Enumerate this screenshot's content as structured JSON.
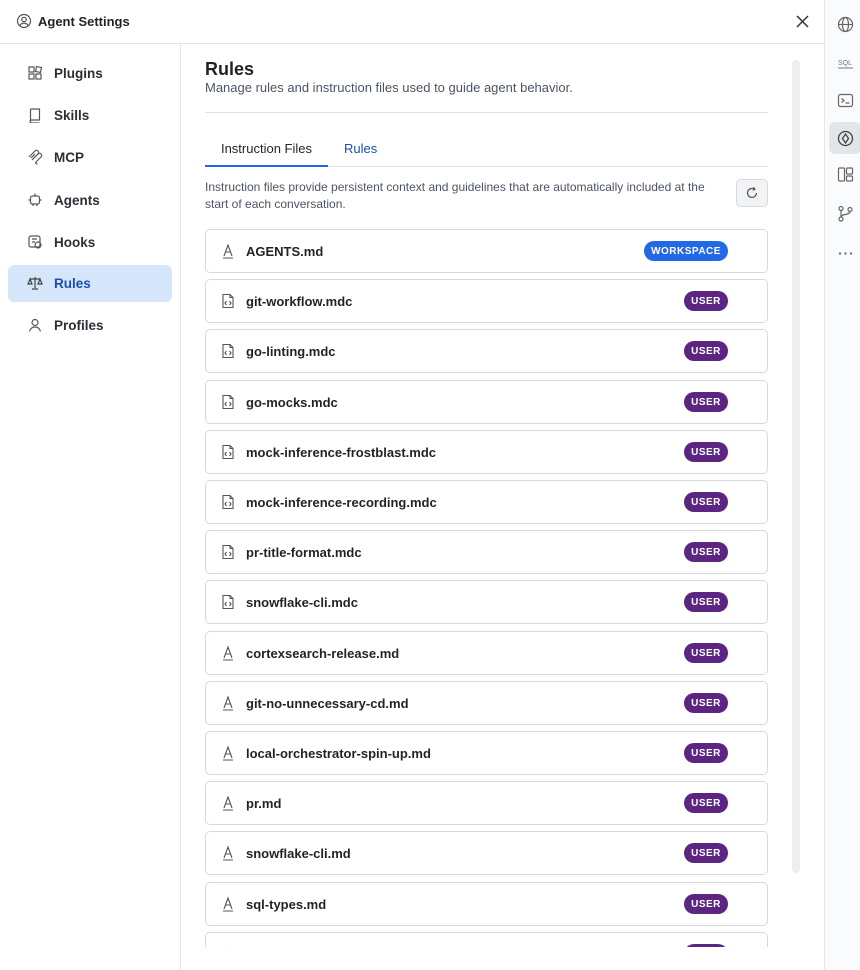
{
  "window": {
    "title": "Agent Settings"
  },
  "sidebar": {
    "items": [
      {
        "label": "Plugins",
        "icon": "puzzle-icon",
        "active": false
      },
      {
        "label": "Skills",
        "icon": "book-icon",
        "active": false
      },
      {
        "label": "MCP",
        "icon": "mcp-icon",
        "active": false
      },
      {
        "label": "Agents",
        "icon": "robot-icon",
        "active": false
      },
      {
        "label": "Hooks",
        "icon": "hook-icon",
        "active": false
      },
      {
        "label": "Rules",
        "icon": "scale-icon",
        "active": true
      },
      {
        "label": "Profiles",
        "icon": "person-icon",
        "active": false
      }
    ]
  },
  "main": {
    "title": "Rules",
    "subtitle": "Manage rules and instruction files used to guide agent behavior.",
    "tabs": [
      {
        "label": "Instruction Files",
        "active": true
      },
      {
        "label": "Rules",
        "active": false
      }
    ],
    "description": "Instruction files provide persistent context and guidelines that are automatically included at the start of each conversation.",
    "files": [
      {
        "name": "AGENTS.md",
        "type": "md",
        "scope": "WORKSPACE"
      },
      {
        "name": "git-workflow.mdc",
        "type": "mdc",
        "scope": "USER"
      },
      {
        "name": "go-linting.mdc",
        "type": "mdc",
        "scope": "USER"
      },
      {
        "name": "go-mocks.mdc",
        "type": "mdc",
        "scope": "USER"
      },
      {
        "name": "mock-inference-frostblast.mdc",
        "type": "mdc",
        "scope": "USER"
      },
      {
        "name": "mock-inference-recording.mdc",
        "type": "mdc",
        "scope": "USER"
      },
      {
        "name": "pr-title-format.mdc",
        "type": "mdc",
        "scope": "USER"
      },
      {
        "name": "snowflake-cli.mdc",
        "type": "mdc",
        "scope": "USER"
      },
      {
        "name": "cortexsearch-release.md",
        "type": "md",
        "scope": "USER"
      },
      {
        "name": "git-no-unnecessary-cd.md",
        "type": "md",
        "scope": "USER"
      },
      {
        "name": "local-orchestrator-spin-up.md",
        "type": "md",
        "scope": "USER"
      },
      {
        "name": "pr.md",
        "type": "md",
        "scope": "USER"
      },
      {
        "name": "snowflake-cli.md",
        "type": "md",
        "scope": "USER"
      },
      {
        "name": "sql-types.md",
        "type": "md",
        "scope": "USER"
      },
      {
        "name": "",
        "type": "md",
        "scope": ""
      }
    ]
  },
  "rail": {
    "icons": [
      "globe-icon",
      "sql-icon",
      "terminal-icon",
      "agent-settings-icon",
      "panels-icon",
      "git-branch-icon",
      "more-icon"
    ],
    "sql_label": "SQL"
  },
  "colors": {
    "accent": "#2563eb",
    "active_nav_bg": "#d6e6fb",
    "workspace_badge": "#2368e6",
    "user_badge": "#5b2581"
  }
}
